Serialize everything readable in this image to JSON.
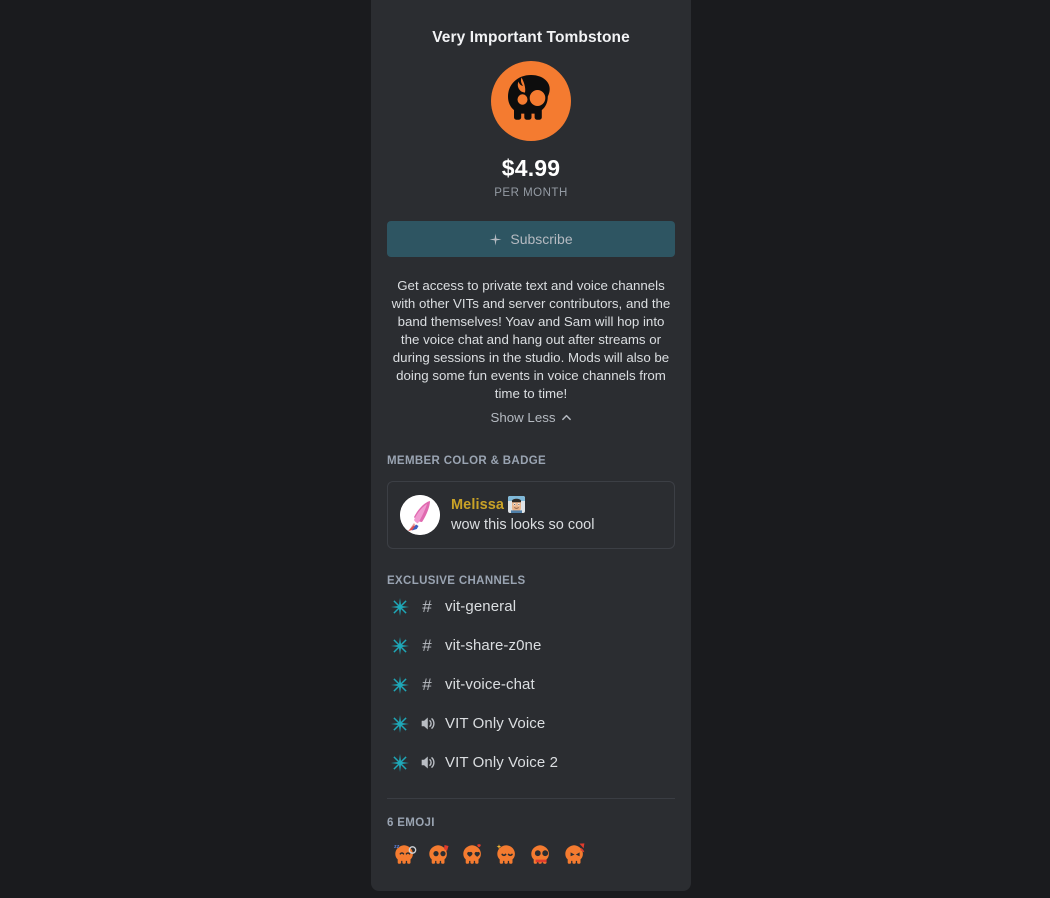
{
  "tier": {
    "title": "Very Important Tombstone",
    "icon_name": "flaming-skull-icon",
    "price": "$4.99",
    "period": "PER MONTH",
    "subscribe_label": "Subscribe",
    "description": "Get access to private text and voice channels with other VITs and server contributors, and the band themselves! Yoav and Sam will hop into the voice chat and hang out after streams or during sessions in the studio. Mods will also be doing some fun events in voice channels from time to time!",
    "show_less_label": "Show Less"
  },
  "member": {
    "heading": "MEMBER COLOR & BADGE",
    "author": "Melissa",
    "author_color": "#c9a227",
    "message": "wow this looks so cool",
    "badge_name": "member-badge-icon",
    "avatar_name": "user-avatar"
  },
  "channels": {
    "heading": "EXCLUSIVE CHANNELS",
    "items": [
      {
        "name": "vit-general",
        "type": "text"
      },
      {
        "name": "vit-share-z0ne",
        "type": "text"
      },
      {
        "name": "vit-voice-chat",
        "type": "text"
      },
      {
        "name": "VIT Only Voice",
        "type": "voice"
      },
      {
        "name": "VIT Only Voice 2",
        "type": "voice"
      }
    ]
  },
  "emoji": {
    "heading": "6 EMOJI",
    "items": [
      {
        "name": "skull-sleeping-emoji"
      },
      {
        "name": "skull-tongue-emoji"
      },
      {
        "name": "skull-heart-eyes-emoji"
      },
      {
        "name": "skull-happy-sparkle-emoji"
      },
      {
        "name": "skull-drip-emoji"
      },
      {
        "name": "skull-devil-emoji"
      }
    ]
  },
  "colors": {
    "accent_orange": "#f47b30",
    "sparkle_teal": "#1fa8b8",
    "button_teal": "#2e5562",
    "card_bg": "#2b2d31",
    "page_bg": "#1a1b1e"
  }
}
